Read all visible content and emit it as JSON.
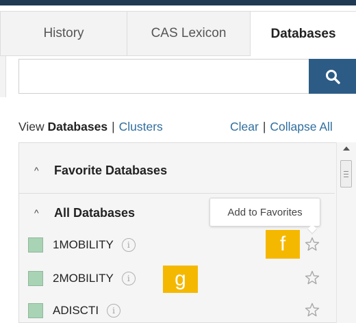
{
  "tabs": [
    {
      "label": "History"
    },
    {
      "label": "CAS Lexicon"
    },
    {
      "label": "Databases",
      "active": true
    }
  ],
  "search": {
    "placeholder": "",
    "value": "",
    "button_icon": "search-icon"
  },
  "view_row": {
    "prefix": "View",
    "databases": "Databases",
    "separator": "|",
    "clusters": "Clusters",
    "clear": "Clear",
    "collapse_all": "Collapse All"
  },
  "groups": {
    "favorites": {
      "label": "Favorite Databases",
      "icon": "chevron-up-icon"
    },
    "all": {
      "label": "All Databases",
      "icon": "chevron-up-icon"
    }
  },
  "databases": [
    {
      "name": "1MOBILITY",
      "favorite": false
    },
    {
      "name": "2MOBILITY",
      "favorite": false
    },
    {
      "name": "ADISCTI",
      "favorite": false
    }
  ],
  "tooltip": {
    "text": "Add to Favorites"
  },
  "markers": {
    "f": "f",
    "g": "g"
  },
  "colors": {
    "accent": "#2c5c86",
    "link": "#2f6e9e",
    "marker": "#f5b800",
    "checkbox": "#a9d3b5"
  }
}
